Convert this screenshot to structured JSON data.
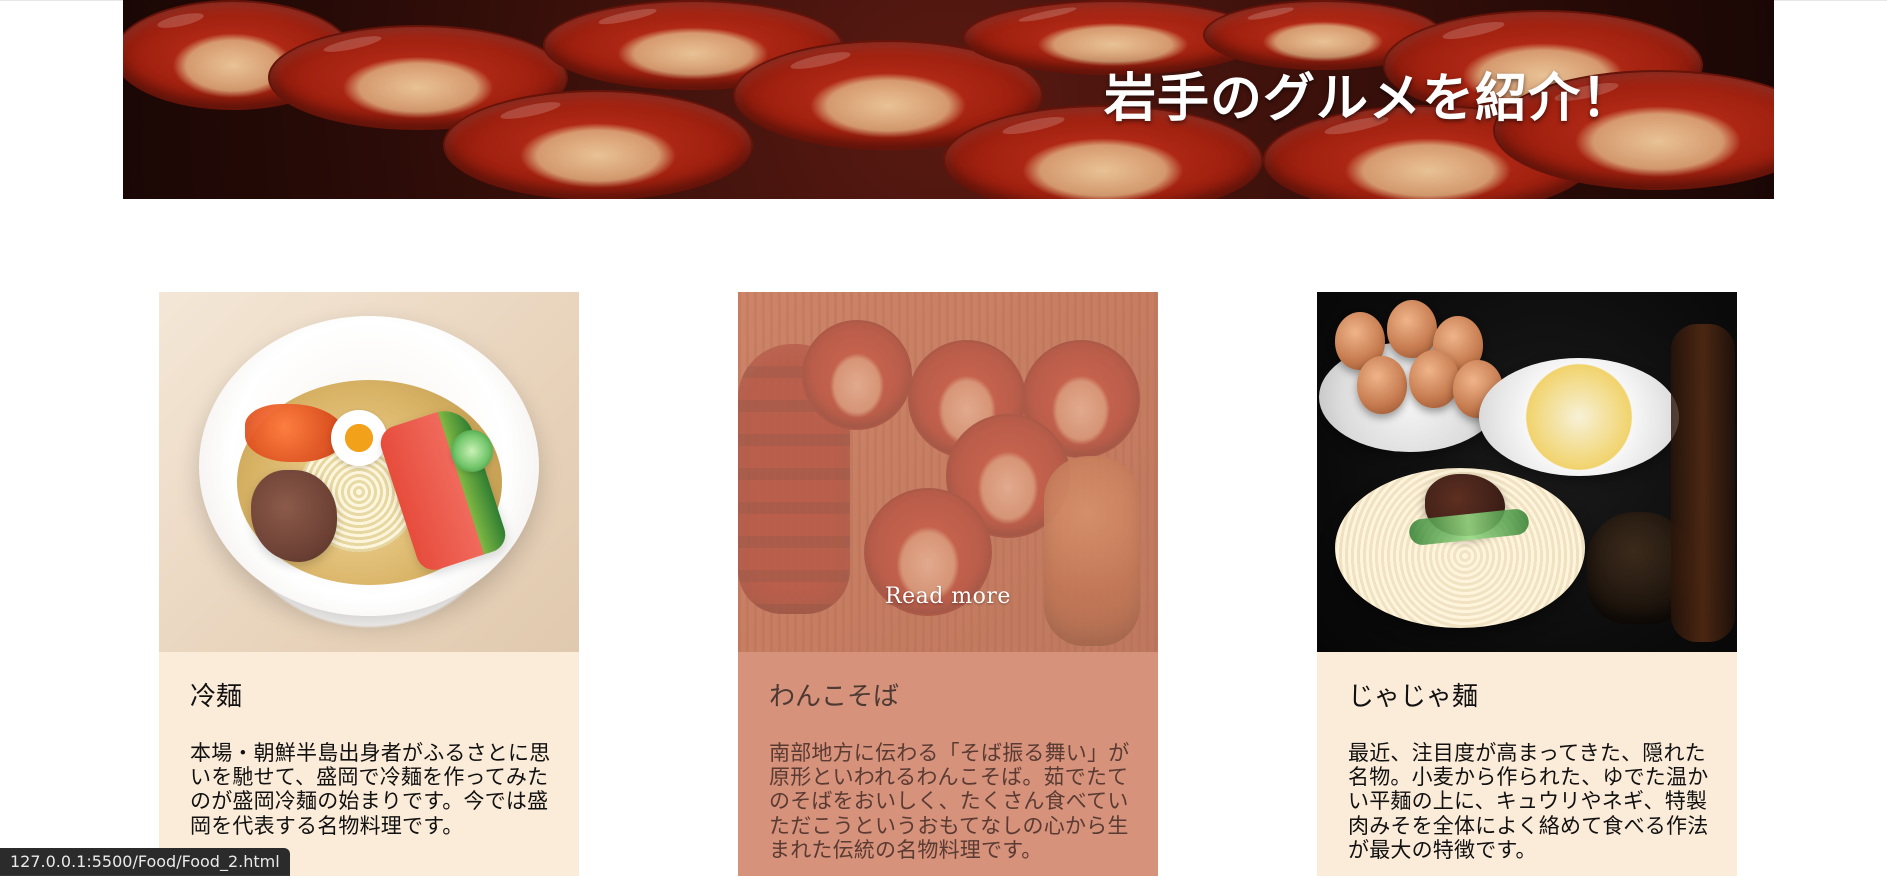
{
  "hero": {
    "title": "岩手のグルメを紹介！"
  },
  "cards": [
    {
      "title": "冷麺",
      "description": "本場・朝鮮半島出身者がふるさとに思いを馳せて、盛岡で冷麺を作ってみたのが盛岡冷麺の始まりです。今では盛岡を代表する名物料理です。"
    },
    {
      "title": "わんこそば",
      "description": "南部地方に伝わる「そば振る舞い」が原形といわれるわんこそば。茹でたてのそばをおいしく、たくさん食べていただこうというおもてなしの心から生まれた伝統の名物料理です。",
      "overlay_text": "Read more"
    },
    {
      "title": "じゃじゃ麺",
      "description": "最近、注目度が高まってきた、隠れた名物。小麦から作られた、ゆでた温かい平麺の上に、キュウリやネギ、特製肉みそを全体によく絡めて食べる作法が最大の特徴です。"
    }
  ],
  "status_bar": {
    "url": "127.0.0.1:5500/Food/Food_2.html"
  }
}
